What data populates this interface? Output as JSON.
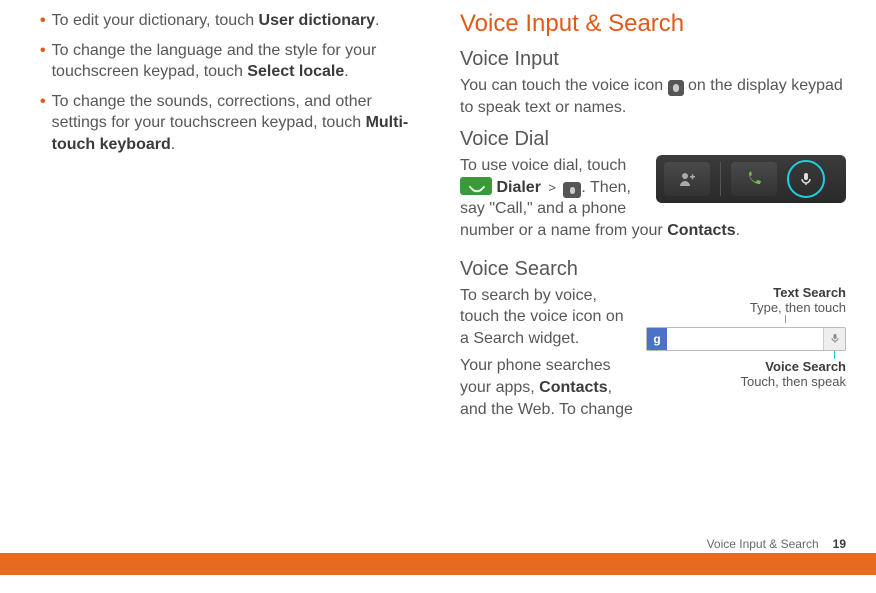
{
  "left": {
    "b1_pre": "To edit your dictionary, touch ",
    "b1_bold": "User dictionary",
    "b1_post": ".",
    "b2_pre": "To change the language and the style for your touchscreen keypad, touch ",
    "b2_bold": "Select locale",
    "b2_post": ".",
    "b3_pre": "To change the sounds, corrections, and other settings for your touchscreen keypad, touch ",
    "b3_bold": "Multi-touch keyboard",
    "b3_post": "."
  },
  "right": {
    "section_title": "Voice Input & Search",
    "voice_input_h": "Voice Input",
    "voice_input_p1": "You can touch the voice icon ",
    "voice_input_p2": " on the display keypad to speak text or names.",
    "voice_dial_h": "Voice Dial",
    "voice_dial_p1": "To use voice dial, touch ",
    "voice_dial_dialer": " Dialer",
    "voice_dial_gt": ">",
    "voice_dial_p2": ". Then, say \"Call,\" and a phone number or a name from your ",
    "voice_dial_bold": "Contacts",
    "voice_dial_p3": ".",
    "voice_search_h": "Voice Search",
    "voice_search_p1": "To search by voice, touch the voice icon on a Search widget.",
    "voice_search_p2a": "Your phone searches your apps, ",
    "voice_search_p2b": "Contacts",
    "voice_search_p2c": ", and the Web. To change",
    "text_search_label": "Text Search",
    "text_search_sub": "Type, then touch",
    "voice_search_label": "Voice Search",
    "voice_search_sub": "Touch, then speak",
    "g_letter": "g"
  },
  "footer": {
    "section": "Voice Input & Search",
    "page": "19"
  }
}
